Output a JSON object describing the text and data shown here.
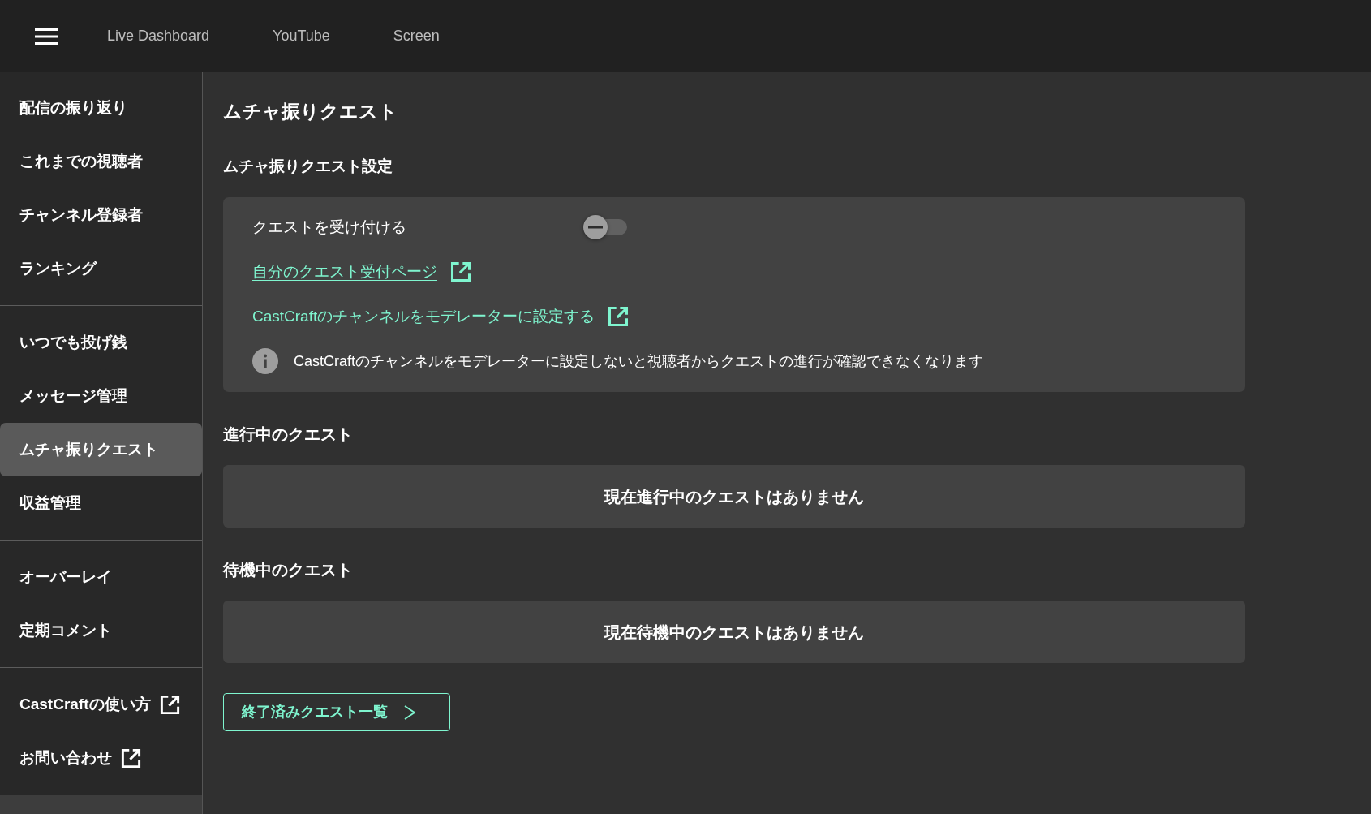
{
  "top_bar": {
    "nav_links": [
      "Live Dashboard",
      "YouTube",
      "Screen"
    ]
  },
  "sidebar": {
    "groups": [
      [
        {
          "label": "配信の振り返り",
          "selected": false,
          "external": false
        },
        {
          "label": "これまでの視聴者",
          "selected": false,
          "external": false
        },
        {
          "label": "チャンネル登録者",
          "selected": false,
          "external": false
        },
        {
          "label": "ランキング",
          "selected": false,
          "external": false
        }
      ],
      [
        {
          "label": "いつでも投げ銭",
          "selected": false,
          "external": false
        },
        {
          "label": "メッセージ管理",
          "selected": false,
          "external": false
        },
        {
          "label": "ムチャ振りクエスト",
          "selected": true,
          "external": false
        },
        {
          "label": "収益管理",
          "selected": false,
          "external": false
        }
      ],
      [
        {
          "label": "オーバーレイ",
          "selected": false,
          "external": false
        },
        {
          "label": "定期コメント",
          "selected": false,
          "external": false
        }
      ],
      [
        {
          "label": "CastCraftの使い方",
          "selected": false,
          "external": true
        },
        {
          "label": "お問い合わせ",
          "selected": false,
          "external": true
        }
      ]
    ]
  },
  "main": {
    "title": "ムチャ振りクエスト",
    "settings": {
      "heading": "ムチャ振りクエスト設定",
      "accept_toggle": {
        "label": "クエストを受け付ける",
        "on": false
      },
      "links": [
        "自分のクエスト受付ページ",
        "CastCraftのチャンネルをモデレーターに設定する"
      ],
      "note": "CastCraftのチャンネルをモデレーターに設定しないと視聴者からクエストの進行が確認できなくなります"
    },
    "sections": [
      {
        "heading": "進行中のクエスト",
        "empty_message": "現在進行中のクエストはありません"
      },
      {
        "heading": "待機中のクエスト",
        "empty_message": "現在待機中のクエストはありません"
      }
    ],
    "history_button": {
      "label": "終了済みクエスト一覧"
    }
  }
}
